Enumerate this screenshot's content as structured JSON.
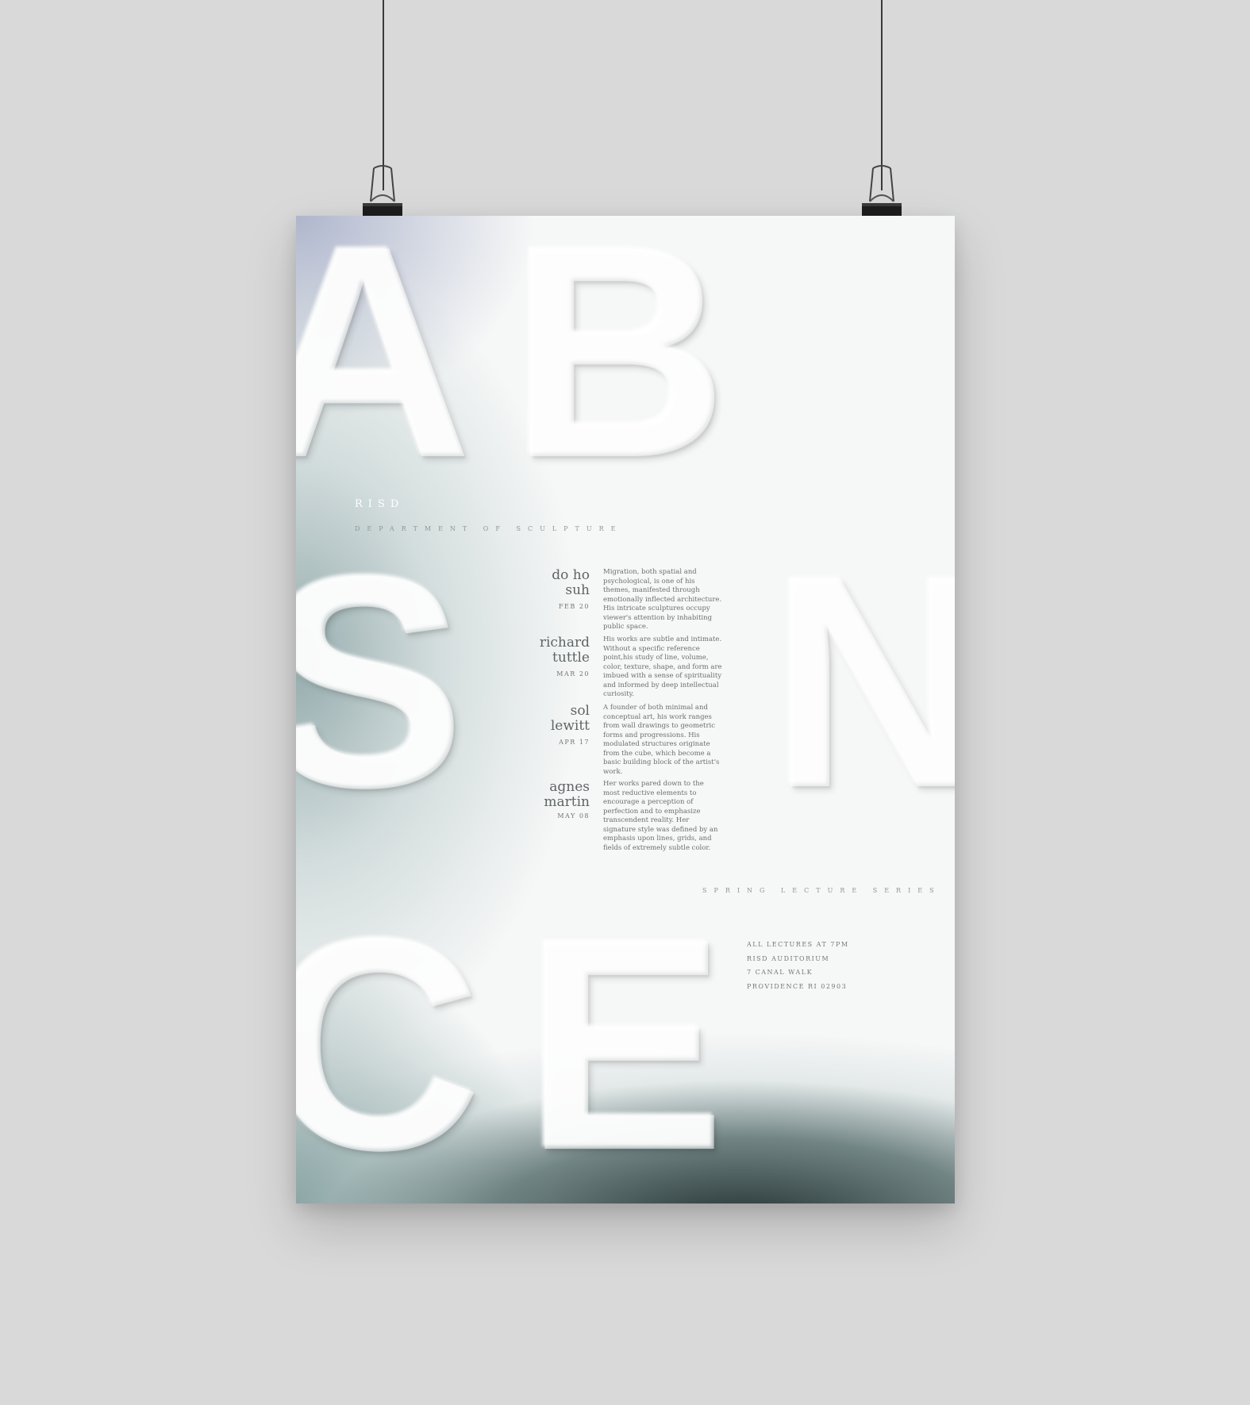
{
  "poster": {
    "letters": [
      "A",
      "B",
      "S",
      "N",
      "C",
      "E"
    ],
    "institution": "RISD",
    "department": "DEPARTMENT OF SCULPTURE",
    "series": "SPRING LECTURE SERIES",
    "lectures": [
      {
        "name_line1": "do ho",
        "name_line2": "suh",
        "date": "FEB 20",
        "description": "Migration, both spatial and psychological, is one of his themes, manifested through emotionally inflected architecture. His intricate sculptures occupy viewer's attention by inhabiting public space."
      },
      {
        "name_line1": "richard",
        "name_line2": "tuttle",
        "date": "MAR 20",
        "description": "His works are subtle and intimate. Without a specific reference point,his study of line, volume, color, texture, shape, and form are imbued with a sense of spirituality and informed by deep intellectual curiosity."
      },
      {
        "name_line1": "sol",
        "name_line2": "lewitt",
        "date": "APR 17",
        "description": "A founder of both minimal and conceptual art, his work ranges from wall drawings to geometric forms and progressions. His modulated structures originate from the cube, which become a basic building block of the artist's work."
      },
      {
        "name_line1": "agnes",
        "name_line2": "martin",
        "date": "MAY 08",
        "description": "Her works pared down to the most reductive elements to encourage a perception of perfection and to emphasize transcendent reality. Her signature style was defined by an emphasis upon lines, grids, and fields of extremely subtle color."
      }
    ],
    "venue": {
      "line1": "ALL LECTURES AT 7PM",
      "line2": "RISD AUDITORIUM",
      "line3": "7 CANAL WALK",
      "line4": "PROVIDENCE RI 02903"
    }
  },
  "colors": {
    "wall": "#d9d9d9",
    "paper": "#f6f7f7",
    "clip": "#1e1e1e"
  },
  "icons": {
    "left_clip": "binder-clip-icon",
    "right_clip": "binder-clip-icon"
  }
}
